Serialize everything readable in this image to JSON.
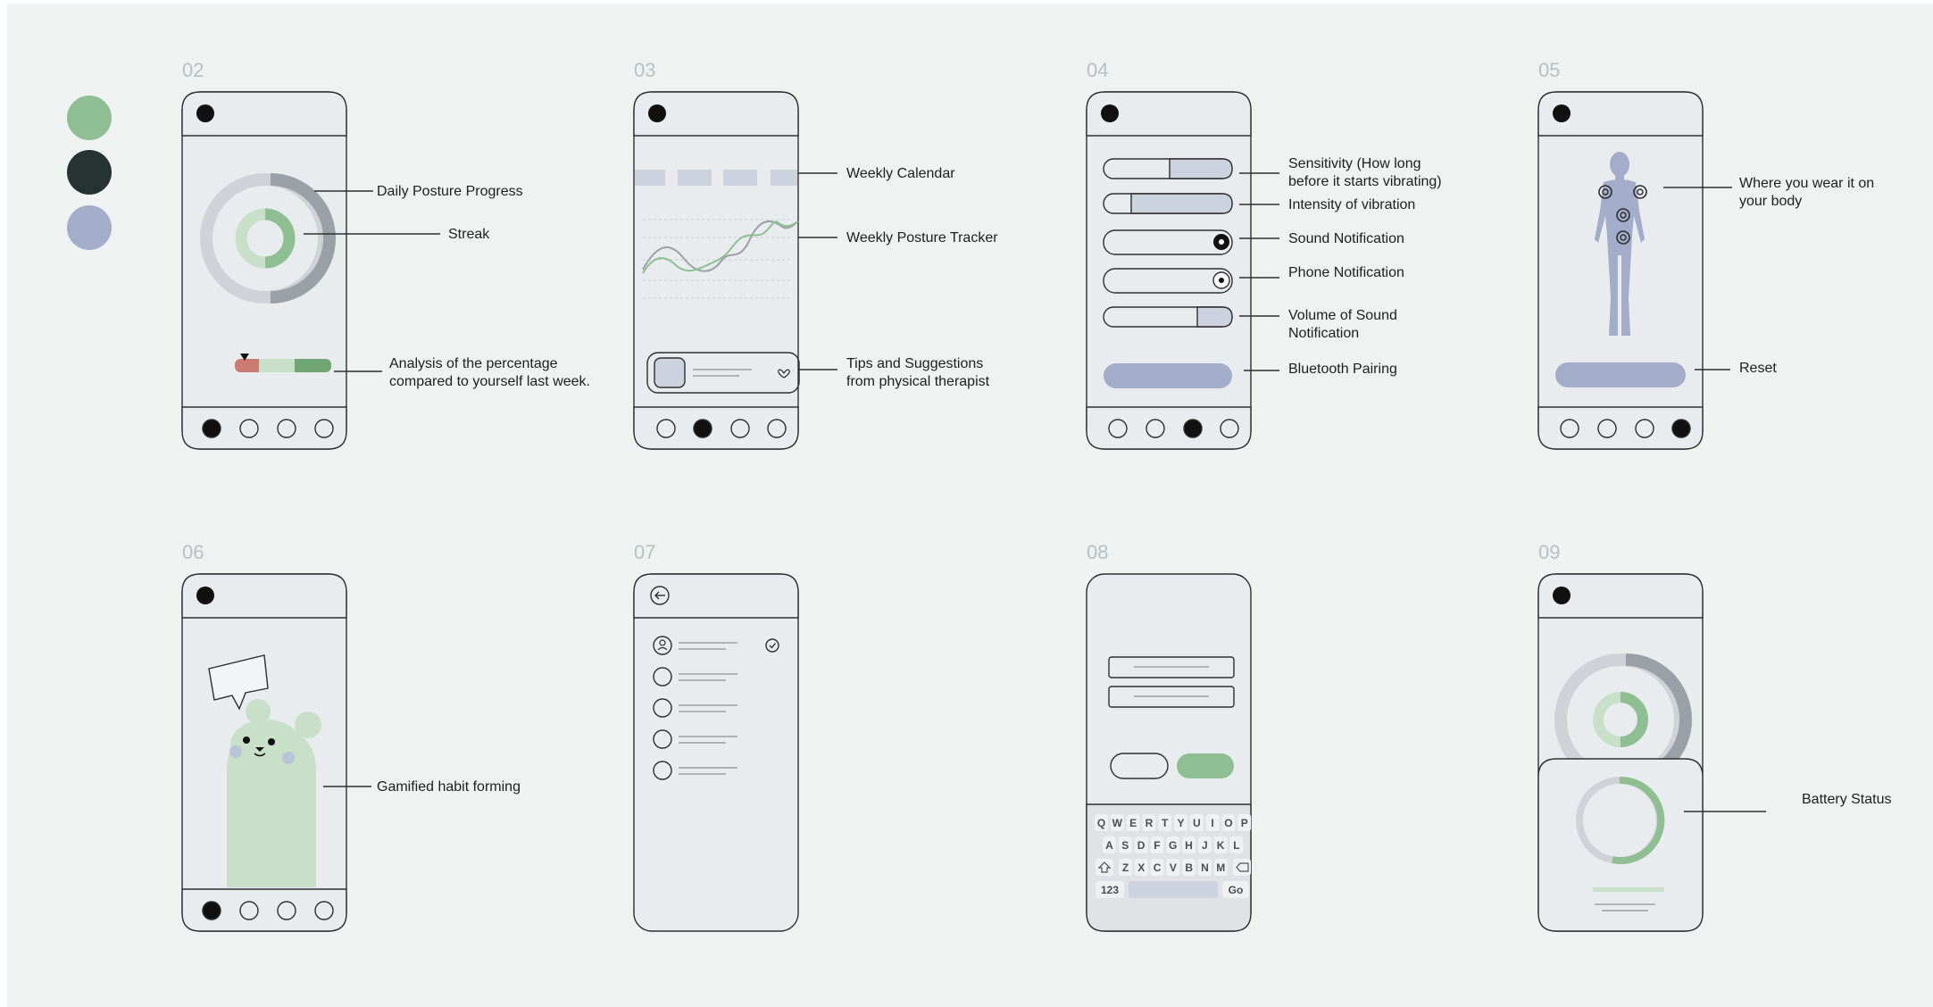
{
  "palette": {
    "swatches": [
      "#8fbe92",
      "#273330",
      "#a3acc9"
    ],
    "green": "#8fbe92",
    "dark": "#273330",
    "lavender": "#a3acc9",
    "light_green": "#c8dfc8",
    "red": "#cc7a73",
    "gray_ring": "#cfd3d8"
  },
  "screens": {
    "s02": {
      "number": "02",
      "labels": {
        "progress": "Daily Posture Progress",
        "streak": "Streak",
        "analysis_1": "Analysis of the percentage",
        "analysis_2": "compared to yourself last week."
      },
      "nav_active": 0
    },
    "s03": {
      "number": "03",
      "labels": {
        "calendar": "Weekly Calendar",
        "tracker": "Weekly Posture Tracker",
        "tips_1": "Tips and Suggestions",
        "tips_2": "from physical therapist"
      },
      "nav_active": 1
    },
    "s04": {
      "number": "04",
      "labels": {
        "sensitivity_1": "Sensitivity (How long",
        "sensitivity_2": "before it starts vibrating)",
        "intensity": "Intensity of vibration",
        "sound": "Sound Notification",
        "phone": "Phone Notification",
        "volume_1": "Volume of Sound",
        "volume_2": "Notification",
        "bluetooth": "Bluetooth Pairing"
      },
      "nav_active": 2
    },
    "s05": {
      "number": "05",
      "labels": {
        "wear_1": "Where you wear it on",
        "wear_2": "your body",
        "reset": "Reset"
      },
      "nav_active": 3
    },
    "s06": {
      "number": "06",
      "labels": {
        "gamified": "Gamified habit forming"
      },
      "nav_active": 0
    },
    "s07": {
      "number": "07"
    },
    "s08": {
      "number": "08",
      "keyboard": {
        "row1": [
          "Q",
          "W",
          "E",
          "R",
          "T",
          "Y",
          "U",
          "I",
          "O",
          "P"
        ],
        "row2": [
          "A",
          "S",
          "D",
          "F",
          "G",
          "H",
          "J",
          "K",
          "L"
        ],
        "row3": [
          "Z",
          "X",
          "C",
          "V",
          "B",
          "N",
          "M"
        ],
        "numbers_key": "123",
        "go_key": "Go"
      }
    },
    "s09": {
      "number": "09",
      "labels": {
        "battery": "Battery Status"
      }
    }
  }
}
